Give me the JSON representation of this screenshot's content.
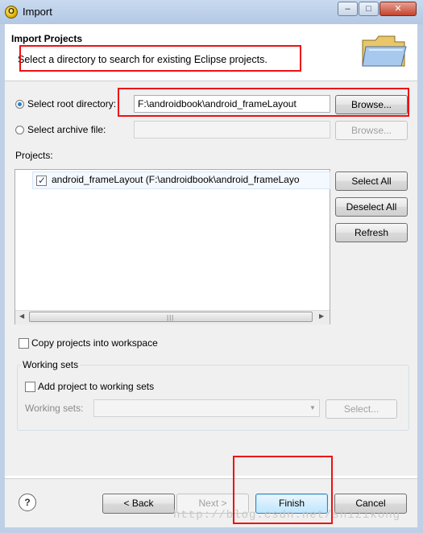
{
  "window": {
    "title": "Import",
    "controls": [
      "minimize-icon",
      "maximize-icon",
      "close-icon"
    ]
  },
  "header": {
    "title": "Import Projects",
    "description": "Select a directory to search for existing Eclipse projects.",
    "icon": "folder-icon"
  },
  "source": {
    "root_label": "Select root directory:",
    "root_value": "F:\\androidbook\\android_frameLayout",
    "root_selected": true,
    "browse_root_label": "Browse...",
    "archive_label": "Select archive file:",
    "archive_value": "",
    "browse_archive_label": "Browse..."
  },
  "projects": {
    "label": "Projects:",
    "items": [
      {
        "checked": true,
        "label": "android_frameLayout (F:\\androidbook\\android_frameLayo"
      }
    ],
    "select_all_label": "Select All",
    "deselect_all_label": "Deselect All",
    "refresh_label": "Refresh"
  },
  "options": {
    "copy_label": "Copy projects into workspace",
    "copy_checked": false
  },
  "working_sets": {
    "group_label": "Working sets",
    "add_label": "Add project to working sets",
    "add_checked": false,
    "sets_label": "Working sets:",
    "sets_value": "",
    "select_label": "Select..."
  },
  "footer": {
    "help_icon": "help-icon",
    "back_label": "< Back",
    "next_label": "Next >",
    "finish_label": "Finish",
    "cancel_label": "Cancel"
  },
  "watermark": "http://blog.csdn.net/shizikong",
  "colors": {
    "highlight_box": "#ee1111",
    "title_bar": "#c9daef",
    "default_button_border": "#3c7fb1"
  }
}
